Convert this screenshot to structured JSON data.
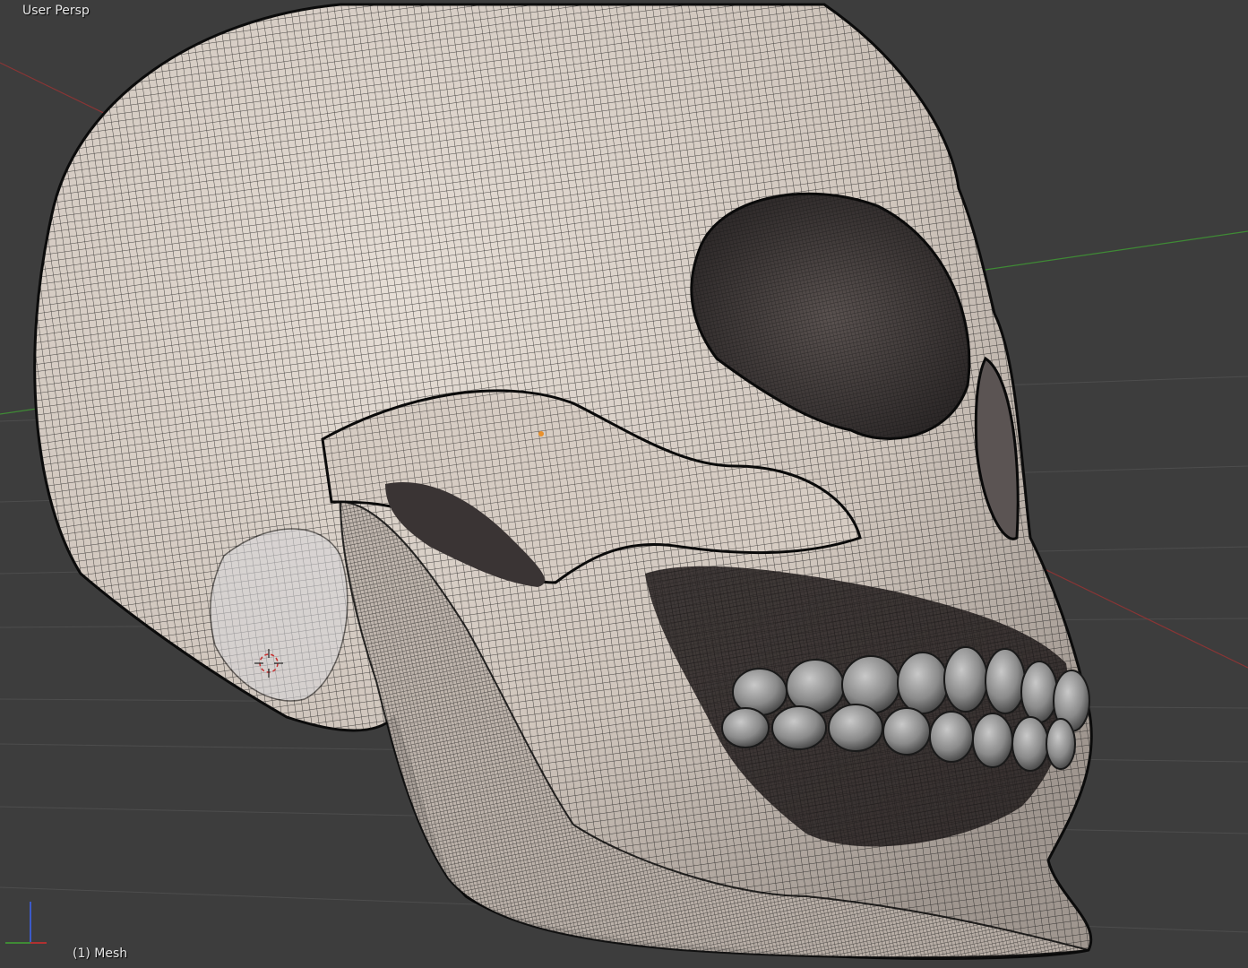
{
  "viewport": {
    "view_name": "User Persp",
    "object_info": "(1) Mesh"
  },
  "scene": {
    "object": "skull-mesh",
    "display": "solid with wireframe overlay",
    "colors": {
      "background": "#3d3d3d",
      "grid_line": "#4d4d4d",
      "x_axis": "#8a3535",
      "y_axis": "#3f8a35",
      "z_axis": "#3c5ac8",
      "bone": "#d9d0c7",
      "wire": "#1a1a1a",
      "teeth": "#8e8e8e",
      "origin_dot": "#e8902c"
    }
  }
}
